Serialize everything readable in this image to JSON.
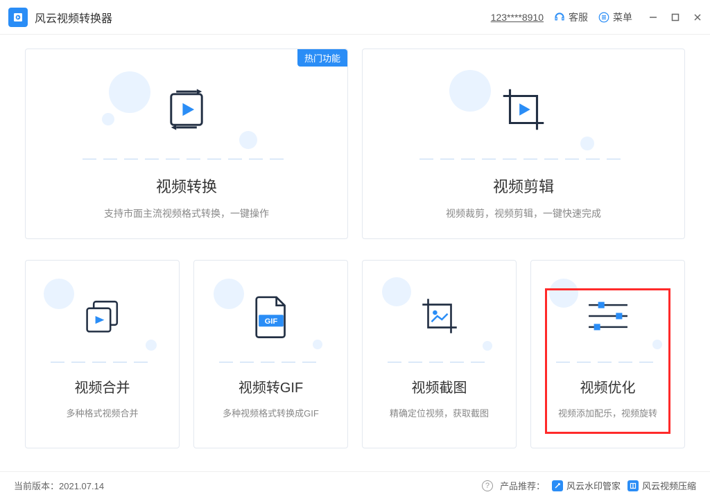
{
  "header": {
    "app_title": "风云视频转换器",
    "user_id": "123****8910",
    "support_label": "客服",
    "menu_label": "菜单"
  },
  "cards": {
    "convert": {
      "title": "视频转换",
      "desc": "支持市面主流视频格式转换，一键操作",
      "badge": "热门功能"
    },
    "edit": {
      "title": "视频剪辑",
      "desc": "视频裁剪，视频剪辑，一键快速完成"
    },
    "merge": {
      "title": "视频合并",
      "desc": "多种格式视频合并"
    },
    "gif": {
      "title": "视频转GIF",
      "desc": "多种视频格式转换成GIF",
      "gif_label": "GIF"
    },
    "shot": {
      "title": "视频截图",
      "desc": "精确定位视频，获取截图"
    },
    "opt": {
      "title": "视频优化",
      "desc": "视频添加配乐，视频旋转"
    }
  },
  "footer": {
    "version_prefix": "当前版本：",
    "version": "2021.07.14",
    "recommend_label": "产品推荐：",
    "rec1": "风云水印管家",
    "rec2": "风云视频压缩"
  }
}
